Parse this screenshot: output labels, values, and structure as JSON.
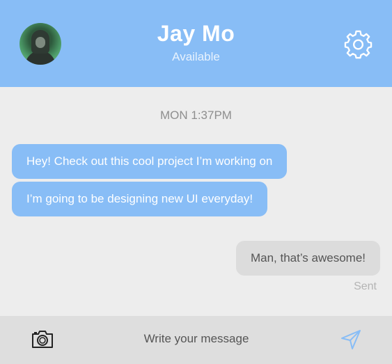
{
  "header": {
    "contact_name": "Jay Mo",
    "status": "Available",
    "avatar_icon": "user-avatar-photo",
    "settings_icon": "gear-icon"
  },
  "conversation": {
    "timestamp": "MON 1:37PM",
    "messages": [
      {
        "direction": "incoming",
        "text": "Hey! Check out this cool project I’m working on"
      },
      {
        "direction": "incoming",
        "text": "I’m going to be designing new UI everyday!"
      },
      {
        "direction": "outgoing",
        "text": "Man, that’s awesome!"
      }
    ],
    "delivery_status": "Sent"
  },
  "composer": {
    "placeholder": "Write your message",
    "camera_icon": "camera-icon",
    "send_icon": "send-icon"
  },
  "colors": {
    "accent": "#88bdf6",
    "background": "#ededed",
    "outgoing_bubble": "#dcdcdc",
    "composer_bar": "#dedede"
  }
}
